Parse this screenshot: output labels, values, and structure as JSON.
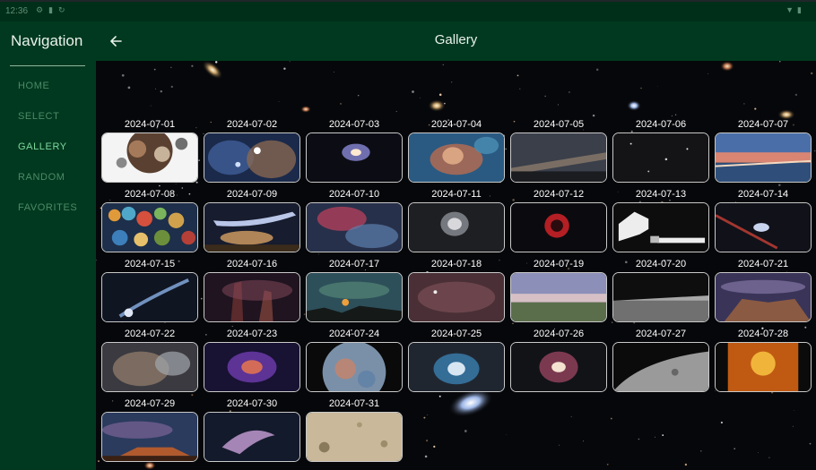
{
  "status_bar": {
    "time": "12:36",
    "left_icons": [
      "settings-icon",
      "sim-card-icon",
      "sync-icon"
    ],
    "right_icons": [
      "wifi-icon",
      "battery-icon"
    ]
  },
  "drawer": {
    "title": "Navigation",
    "items": [
      {
        "label": "HOME",
        "active": false
      },
      {
        "label": "SELECT",
        "active": false
      },
      {
        "label": "GALLERY",
        "active": true
      },
      {
        "label": "RANDOM",
        "active": false
      },
      {
        "label": "FAVORITES",
        "active": false
      }
    ]
  },
  "topbar": {
    "title": "Gallery",
    "back_icon": "arrow-left-icon"
  },
  "colors": {
    "drawer_bg": "#00391f",
    "nav_active": "#7fd89e",
    "nav_inactive": "#4d8a67",
    "title_text": "#eaf2ec"
  },
  "gallery": [
    {
      "date": "2024-07-01"
    },
    {
      "date": "2024-07-02"
    },
    {
      "date": "2024-07-03"
    },
    {
      "date": "2024-07-04"
    },
    {
      "date": "2024-07-05"
    },
    {
      "date": "2024-07-06"
    },
    {
      "date": "2024-07-07"
    },
    {
      "date": "2024-07-08"
    },
    {
      "date": "2024-07-09"
    },
    {
      "date": "2024-07-10"
    },
    {
      "date": "2024-07-11"
    },
    {
      "date": "2024-07-12"
    },
    {
      "date": "2024-07-13"
    },
    {
      "date": "2024-07-14"
    },
    {
      "date": "2024-07-15"
    },
    {
      "date": "2024-07-16"
    },
    {
      "date": "2024-07-17"
    },
    {
      "date": "2024-07-18"
    },
    {
      "date": "2024-07-19"
    },
    {
      "date": "2024-07-20"
    },
    {
      "date": "2024-07-21"
    },
    {
      "date": "2024-07-22"
    },
    {
      "date": "2024-07-23"
    },
    {
      "date": "2024-07-24"
    },
    {
      "date": "2024-07-25"
    },
    {
      "date": "2024-07-26"
    },
    {
      "date": "2024-07-27"
    },
    {
      "date": "2024-07-28"
    },
    {
      "date": "2024-07-29"
    },
    {
      "date": "2024-07-30"
    },
    {
      "date": "2024-07-31"
    }
  ]
}
